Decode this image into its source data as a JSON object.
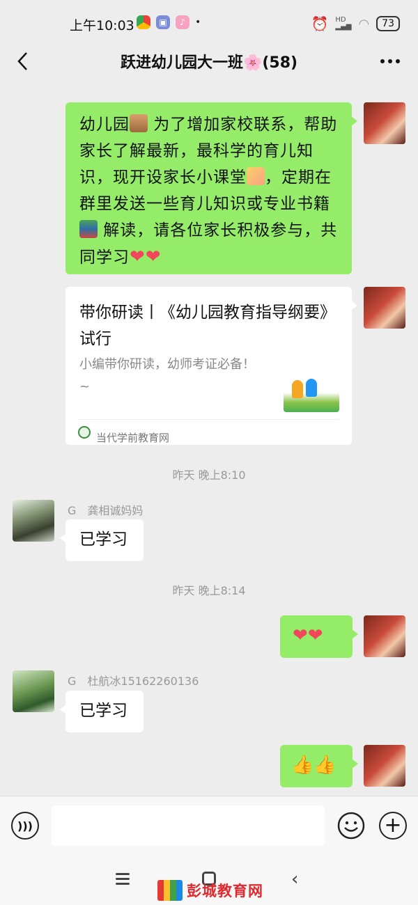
{
  "status_bar": {
    "time": "上午10:03",
    "app_icons": [
      "chrome-like-icon",
      "gallery-icon",
      "tiktok-icon"
    ],
    "signal": "HD",
    "battery": "73"
  },
  "header": {
    "title": "跃进幼儿园大一班🌸(58)"
  },
  "messages": {
    "m1": {
      "line1": "幼儿园",
      "line1b": " 为了增加家校联系，帮助家长了解最新，最科学的育儿知识，现开设家长小课堂",
      "line2": "，定期在群里发送一些育儿知识或专业书籍",
      "line3": " 解读，请各位家长积极参与，共同学习",
      "hearts": "❤❤"
    },
    "card": {
      "title": "带你研读丨《幼儿园教育指导纲要》试行",
      "desc": "小编带你研读，幼师考证必备！~",
      "source": "当代学前教育网"
    },
    "ts1": "昨天 晚上8:10",
    "g1": {
      "name": "G　龚相诚妈妈",
      "text": "已学习"
    },
    "ts2": "昨天 晚上8:14",
    "self_hearts": "❤❤",
    "g2": {
      "name": "G　杜航冰15162260136",
      "text": "已学习"
    },
    "thumbs": "👍👍"
  },
  "input": {
    "value": "",
    "placeholder": ""
  },
  "watermark": {
    "text": "彭城教育网"
  },
  "colors": {
    "self_bubble": "#95ec69",
    "other_bubble": "#ffffff",
    "background": "#ededed",
    "heart": "#f0475a"
  }
}
